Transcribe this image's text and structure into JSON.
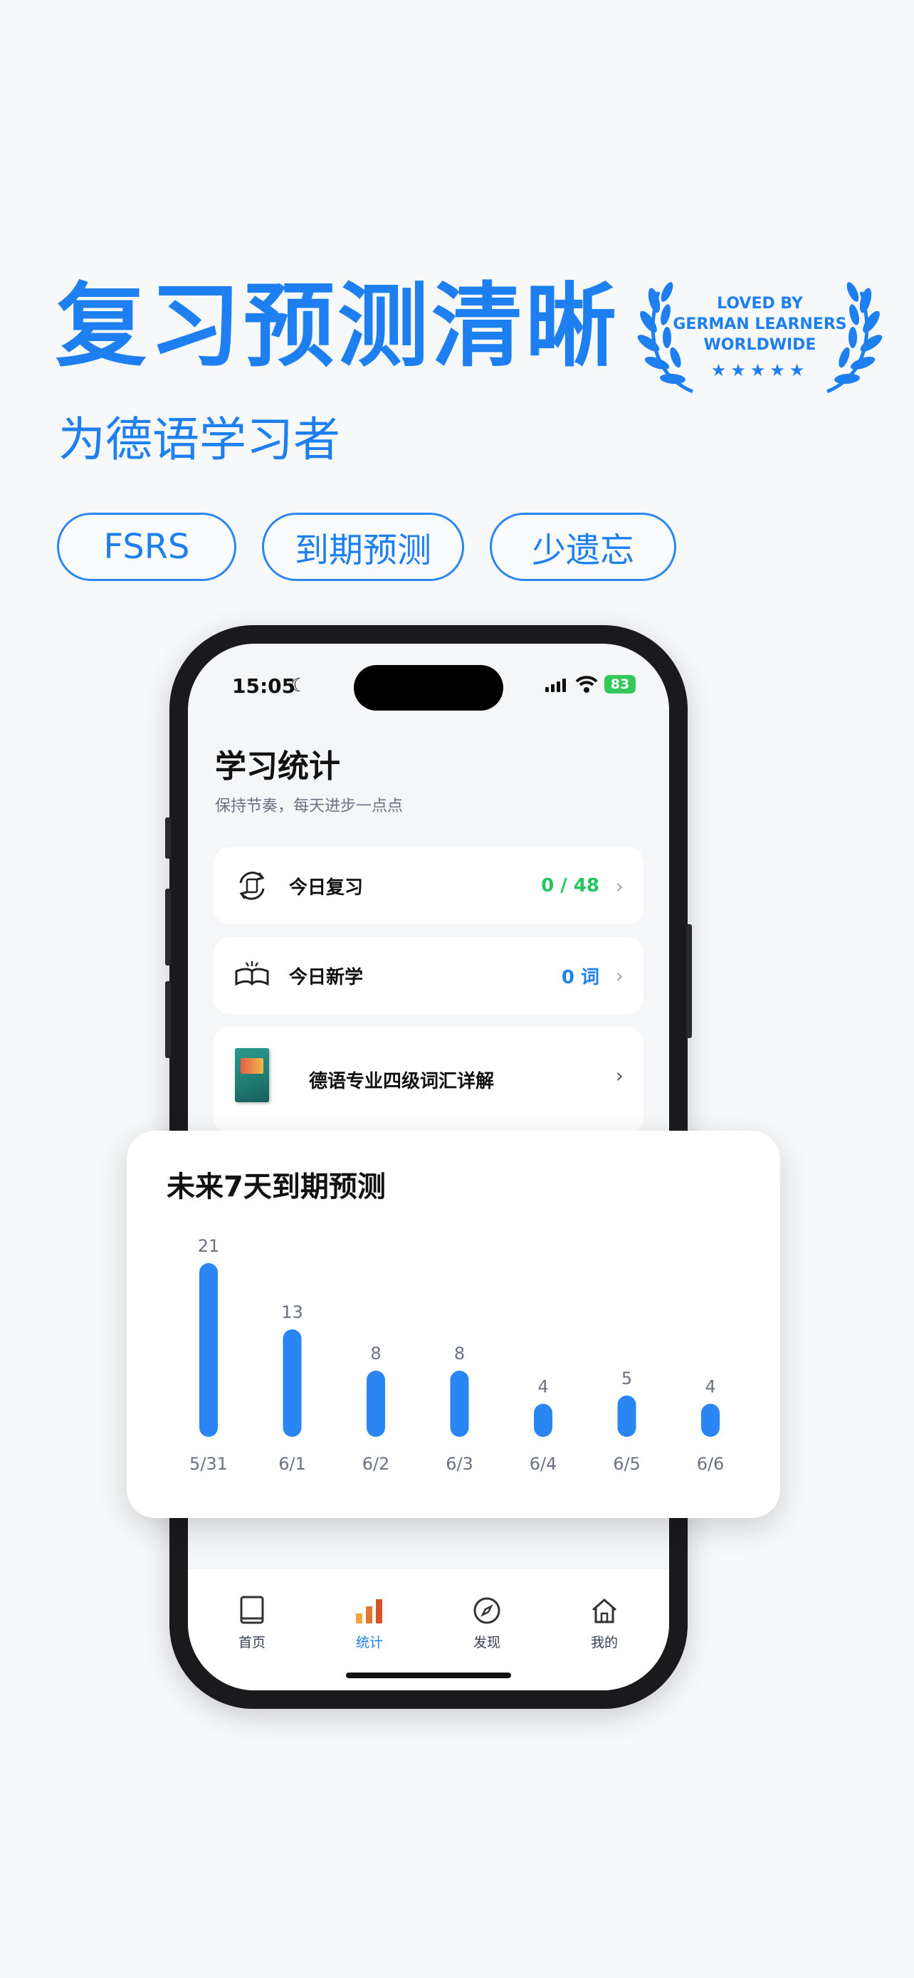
{
  "promo": {
    "headline": "复习预测清晰",
    "subhead": "为德语学习者",
    "pills": [
      "FSRS",
      "到期预测",
      "少遗忘"
    ],
    "badge": {
      "line1": "LOVED BY",
      "line2": "GERMAN LEARNERS",
      "line3": "WORLDWIDE",
      "stars": "★★★★★"
    }
  },
  "status_bar": {
    "time": "15:05",
    "moon": "☾",
    "battery": "83"
  },
  "screen": {
    "title": "学习统计",
    "subtitle": "保持节奏，每天进步一点点",
    "cards": {
      "review": {
        "label": "今日复习",
        "value": "0 / 48",
        "chevron": "›"
      },
      "new": {
        "label": "今日新学",
        "value": "0 词",
        "chevron": "›"
      },
      "book": {
        "label": "德语专业四级词汇详解",
        "chevron": "›"
      }
    }
  },
  "tabbar": {
    "items": [
      {
        "label": "首页",
        "icon": "book-icon"
      },
      {
        "label": "统计",
        "icon": "bar-chart-icon",
        "active": true
      },
      {
        "label": "发现",
        "icon": "compass-icon"
      },
      {
        "label": "我的",
        "icon": "house-icon"
      }
    ]
  },
  "forecast": {
    "title": "未来7天到期预测"
  },
  "chart_data": {
    "type": "bar",
    "title": "未来7天到期预测",
    "categories": [
      "5/31",
      "6/1",
      "6/2",
      "6/3",
      "6/4",
      "6/5",
      "6/6"
    ],
    "values": [
      21,
      13,
      8,
      8,
      4,
      5,
      4
    ],
    "bar_color": "#2a86f2",
    "data_labels": true,
    "grid": false,
    "ylim": [
      0,
      21
    ]
  },
  "colors": {
    "accent": "#1e7ff0",
    "green": "#22c55e"
  }
}
